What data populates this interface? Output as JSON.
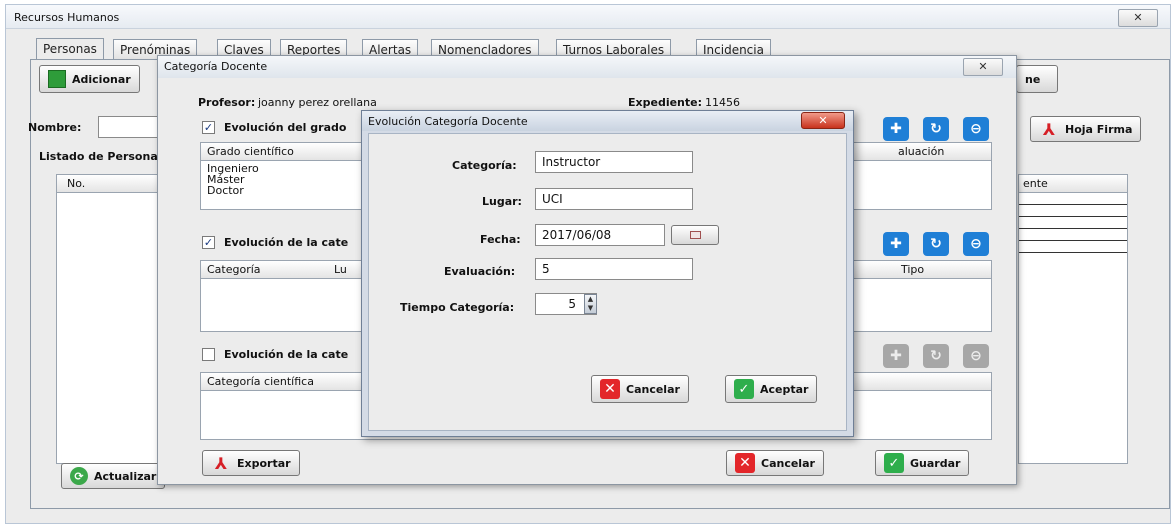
{
  "window": {
    "title": "Recursos Humanos",
    "close_label": "✕"
  },
  "tabs": [
    "Personas",
    "Prenóminas",
    "Claves",
    "Reportes",
    "Alertas",
    "Nomencladores",
    "Turnos Laborales",
    "Incidencia"
  ],
  "personas": {
    "add_button": "Adicionar",
    "name_label": "Nombre:",
    "list_heading": "Listado de Personal",
    "col_no": "No.",
    "col_right": "ente",
    "hoja_firma_button": "Hoja Firma",
    "update_button": "Actualizar",
    "top_right_button_fragment": "ne"
  },
  "dialog_categoria": {
    "title": "Categoría Docente",
    "close_label": "✕",
    "profesor_label": "Profesor:",
    "profesor_value": "joanny perez orellana",
    "expediente_label": "Expediente:",
    "expediente_value": "11456",
    "section1": {
      "label": "Evolución del grado",
      "checked": true,
      "col1": "Grado científico",
      "col_right": "aluación",
      "rows": [
        "Ingeniero",
        "Máster",
        "Doctor"
      ]
    },
    "section2": {
      "label": "Evolución de la cate",
      "checked": true,
      "col1": "Categoría",
      "col2": "Lu",
      "col_right": "Tipo"
    },
    "section3": {
      "label": "Evolución de la cate",
      "checked": false,
      "col1": "Categoría científica"
    },
    "export_button": "Exportar",
    "cancel_button": "Cancelar",
    "save_button": "Guardar"
  },
  "dialog_evolucion": {
    "title": "Evolución Categoría Docente",
    "close_label": "✕",
    "categoria_label": "Categoría:",
    "categoria_value": "Instructor",
    "lugar_label": "Lugar:",
    "lugar_value": "UCI",
    "fecha_label": "Fecha:",
    "fecha_value": "2017/06/08",
    "evaluacion_label": "Evaluación:",
    "evaluacion_value": "5",
    "tiempo_label": "Tiempo Categoría:",
    "tiempo_value": "5",
    "cancel_button": "Cancelar",
    "accept_button": "Aceptar"
  }
}
